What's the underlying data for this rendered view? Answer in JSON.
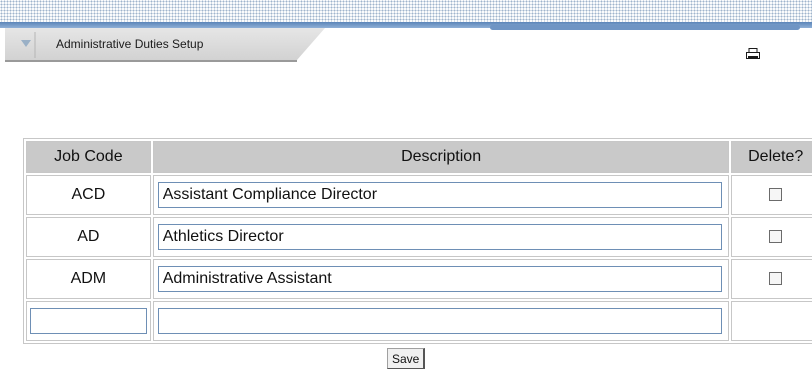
{
  "header": {
    "title": "Administrative Duties Setup",
    "collapse_icon": "triangle-down-icon",
    "print_icon": "printer-icon"
  },
  "table": {
    "columns": [
      "Job Code",
      "Description",
      "Delete?"
    ],
    "rows": [
      {
        "code": "ACD",
        "description": "Assistant Compliance Director",
        "delete": false
      },
      {
        "code": "AD",
        "description": "Athletics Director",
        "delete": false
      },
      {
        "code": "ADM",
        "description": "Administrative Assistant",
        "delete": false
      }
    ],
    "new_row": {
      "code": "",
      "description": ""
    }
  },
  "actions": {
    "save_label": "Save"
  },
  "colors": {
    "header_bg": "#c9c9c9",
    "accent_blue": "#5b85b8",
    "border": "#c7c7c7"
  }
}
